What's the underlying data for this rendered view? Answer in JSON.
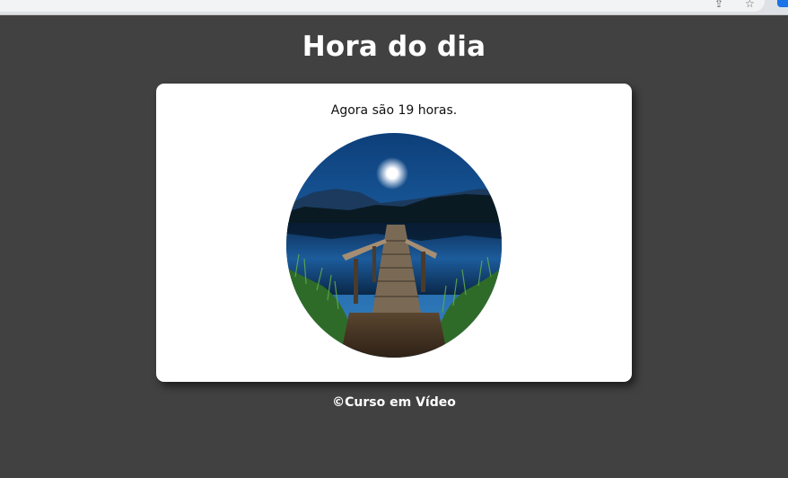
{
  "browser": {
    "share_icon": "share-icon",
    "bookmark_icon": "star-icon"
  },
  "header": {
    "title": "Hora do dia"
  },
  "main": {
    "message": "Agora são 19 horas.",
    "image_description_icon": "night-lake-pier-photo"
  },
  "footer": {
    "text": "©Curso em Vídeo"
  },
  "colors": {
    "background": "#414141",
    "card": "#ffffff",
    "title": "#ffffff"
  }
}
